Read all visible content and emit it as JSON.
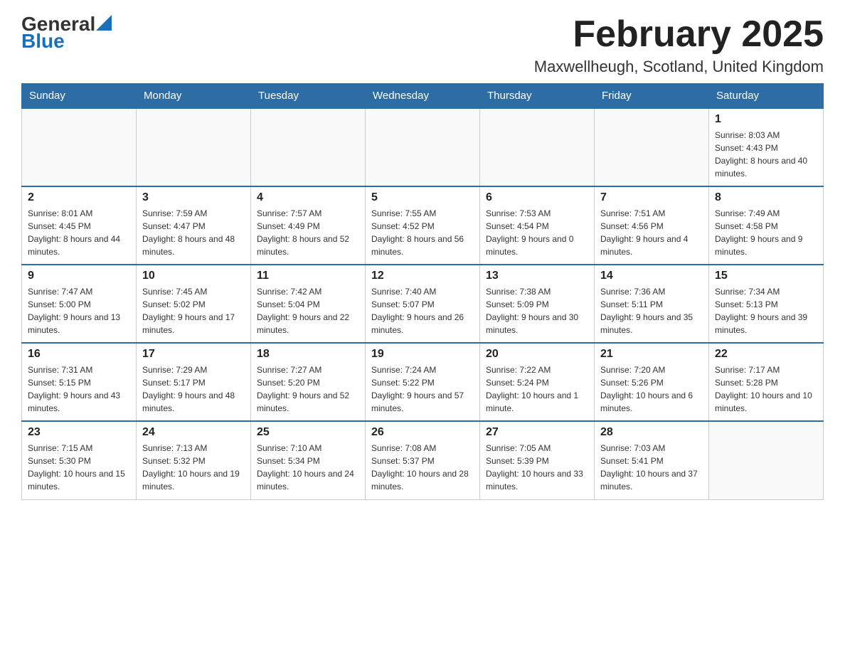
{
  "header": {
    "logo_general": "General",
    "logo_blue": "Blue",
    "month_title": "February 2025",
    "location": "Maxwellheugh, Scotland, United Kingdom"
  },
  "days_of_week": [
    "Sunday",
    "Monday",
    "Tuesday",
    "Wednesday",
    "Thursday",
    "Friday",
    "Saturday"
  ],
  "weeks": [
    [
      {
        "day": "",
        "sunrise": "",
        "sunset": "",
        "daylight": ""
      },
      {
        "day": "",
        "sunrise": "",
        "sunset": "",
        "daylight": ""
      },
      {
        "day": "",
        "sunrise": "",
        "sunset": "",
        "daylight": ""
      },
      {
        "day": "",
        "sunrise": "",
        "sunset": "",
        "daylight": ""
      },
      {
        "day": "",
        "sunrise": "",
        "sunset": "",
        "daylight": ""
      },
      {
        "day": "",
        "sunrise": "",
        "sunset": "",
        "daylight": ""
      },
      {
        "day": "1",
        "sunrise": "Sunrise: 8:03 AM",
        "sunset": "Sunset: 4:43 PM",
        "daylight": "Daylight: 8 hours and 40 minutes."
      }
    ],
    [
      {
        "day": "2",
        "sunrise": "Sunrise: 8:01 AM",
        "sunset": "Sunset: 4:45 PM",
        "daylight": "Daylight: 8 hours and 44 minutes."
      },
      {
        "day": "3",
        "sunrise": "Sunrise: 7:59 AM",
        "sunset": "Sunset: 4:47 PM",
        "daylight": "Daylight: 8 hours and 48 minutes."
      },
      {
        "day": "4",
        "sunrise": "Sunrise: 7:57 AM",
        "sunset": "Sunset: 4:49 PM",
        "daylight": "Daylight: 8 hours and 52 minutes."
      },
      {
        "day": "5",
        "sunrise": "Sunrise: 7:55 AM",
        "sunset": "Sunset: 4:52 PM",
        "daylight": "Daylight: 8 hours and 56 minutes."
      },
      {
        "day": "6",
        "sunrise": "Sunrise: 7:53 AM",
        "sunset": "Sunset: 4:54 PM",
        "daylight": "Daylight: 9 hours and 0 minutes."
      },
      {
        "day": "7",
        "sunrise": "Sunrise: 7:51 AM",
        "sunset": "Sunset: 4:56 PM",
        "daylight": "Daylight: 9 hours and 4 minutes."
      },
      {
        "day": "8",
        "sunrise": "Sunrise: 7:49 AM",
        "sunset": "Sunset: 4:58 PM",
        "daylight": "Daylight: 9 hours and 9 minutes."
      }
    ],
    [
      {
        "day": "9",
        "sunrise": "Sunrise: 7:47 AM",
        "sunset": "Sunset: 5:00 PM",
        "daylight": "Daylight: 9 hours and 13 minutes."
      },
      {
        "day": "10",
        "sunrise": "Sunrise: 7:45 AM",
        "sunset": "Sunset: 5:02 PM",
        "daylight": "Daylight: 9 hours and 17 minutes."
      },
      {
        "day": "11",
        "sunrise": "Sunrise: 7:42 AM",
        "sunset": "Sunset: 5:04 PM",
        "daylight": "Daylight: 9 hours and 22 minutes."
      },
      {
        "day": "12",
        "sunrise": "Sunrise: 7:40 AM",
        "sunset": "Sunset: 5:07 PM",
        "daylight": "Daylight: 9 hours and 26 minutes."
      },
      {
        "day": "13",
        "sunrise": "Sunrise: 7:38 AM",
        "sunset": "Sunset: 5:09 PM",
        "daylight": "Daylight: 9 hours and 30 minutes."
      },
      {
        "day": "14",
        "sunrise": "Sunrise: 7:36 AM",
        "sunset": "Sunset: 5:11 PM",
        "daylight": "Daylight: 9 hours and 35 minutes."
      },
      {
        "day": "15",
        "sunrise": "Sunrise: 7:34 AM",
        "sunset": "Sunset: 5:13 PM",
        "daylight": "Daylight: 9 hours and 39 minutes."
      }
    ],
    [
      {
        "day": "16",
        "sunrise": "Sunrise: 7:31 AM",
        "sunset": "Sunset: 5:15 PM",
        "daylight": "Daylight: 9 hours and 43 minutes."
      },
      {
        "day": "17",
        "sunrise": "Sunrise: 7:29 AM",
        "sunset": "Sunset: 5:17 PM",
        "daylight": "Daylight: 9 hours and 48 minutes."
      },
      {
        "day": "18",
        "sunrise": "Sunrise: 7:27 AM",
        "sunset": "Sunset: 5:20 PM",
        "daylight": "Daylight: 9 hours and 52 minutes."
      },
      {
        "day": "19",
        "sunrise": "Sunrise: 7:24 AM",
        "sunset": "Sunset: 5:22 PM",
        "daylight": "Daylight: 9 hours and 57 minutes."
      },
      {
        "day": "20",
        "sunrise": "Sunrise: 7:22 AM",
        "sunset": "Sunset: 5:24 PM",
        "daylight": "Daylight: 10 hours and 1 minute."
      },
      {
        "day": "21",
        "sunrise": "Sunrise: 7:20 AM",
        "sunset": "Sunset: 5:26 PM",
        "daylight": "Daylight: 10 hours and 6 minutes."
      },
      {
        "day": "22",
        "sunrise": "Sunrise: 7:17 AM",
        "sunset": "Sunset: 5:28 PM",
        "daylight": "Daylight: 10 hours and 10 minutes."
      }
    ],
    [
      {
        "day": "23",
        "sunrise": "Sunrise: 7:15 AM",
        "sunset": "Sunset: 5:30 PM",
        "daylight": "Daylight: 10 hours and 15 minutes."
      },
      {
        "day": "24",
        "sunrise": "Sunrise: 7:13 AM",
        "sunset": "Sunset: 5:32 PM",
        "daylight": "Daylight: 10 hours and 19 minutes."
      },
      {
        "day": "25",
        "sunrise": "Sunrise: 7:10 AM",
        "sunset": "Sunset: 5:34 PM",
        "daylight": "Daylight: 10 hours and 24 minutes."
      },
      {
        "day": "26",
        "sunrise": "Sunrise: 7:08 AM",
        "sunset": "Sunset: 5:37 PM",
        "daylight": "Daylight: 10 hours and 28 minutes."
      },
      {
        "day": "27",
        "sunrise": "Sunrise: 7:05 AM",
        "sunset": "Sunset: 5:39 PM",
        "daylight": "Daylight: 10 hours and 33 minutes."
      },
      {
        "day": "28",
        "sunrise": "Sunrise: 7:03 AM",
        "sunset": "Sunset: 5:41 PM",
        "daylight": "Daylight: 10 hours and 37 minutes."
      },
      {
        "day": "",
        "sunrise": "",
        "sunset": "",
        "daylight": ""
      }
    ]
  ]
}
